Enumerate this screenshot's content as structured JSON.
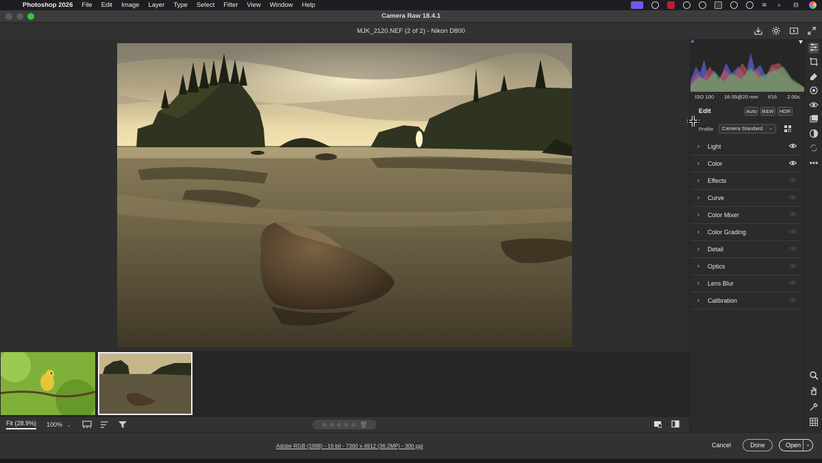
{
  "menubar": {
    "app_name": "Photoshop 2026",
    "items": [
      "File",
      "Edit",
      "Image",
      "Layer",
      "Type",
      "Select",
      "Filter",
      "View",
      "Window",
      "Help"
    ]
  },
  "window": {
    "title": "Camera Raw 18.4.1"
  },
  "filebar": {
    "filename": "MJK_2120.NEF (2 of 2)  -  Nikon D800"
  },
  "filmstrip": {
    "thumbnails": [
      {
        "subject": "yellow-bird-on-branch",
        "selected": false
      },
      {
        "subject": "beach-sea-stacks-sunset",
        "selected": true
      }
    ]
  },
  "bottombar": {
    "zoom_fit": "Fit (28.9%)",
    "zoom_percent": "100%",
    "rating_stars": "☆ ☆ ☆ ☆ ☆",
    "rating_value": 0
  },
  "footer": {
    "image_meta": "Adobe RGB (1998) - 16 bit - 7360 x 4912 (36.2MP) - 300 ppi",
    "cancel_label": "Cancel",
    "done_label": "Done",
    "open_label": "Open"
  },
  "panel": {
    "exif": {
      "iso": "ISO 100",
      "lens": "16-35@20 mm",
      "aperture": "f/16",
      "shutter": "2.00s"
    },
    "edit_label": "Edit",
    "auto_label": "Auto",
    "bw_label": "B&W",
    "hdr_label": "HDR",
    "profile_label": "Profile",
    "profile_value": "Camera Standard",
    "sections": [
      {
        "label": "Light",
        "eye_visible": true
      },
      {
        "label": "Color",
        "eye_visible": true
      },
      {
        "label": "Effects",
        "eye_visible": false
      },
      {
        "label": "Curve",
        "eye_visible": false
      },
      {
        "label": "Color Mixer",
        "eye_visible": false
      },
      {
        "label": "Color Grading",
        "eye_visible": false
      },
      {
        "label": "Detail",
        "eye_visible": false
      },
      {
        "label": "Optics",
        "eye_visible": false
      },
      {
        "label": "Lens Blur",
        "eye_visible": false
      },
      {
        "label": "Calibration",
        "eye_visible": false
      }
    ]
  },
  "colors": {
    "menubar_bg": "#1d1d22",
    "canvas_bg": "#2e2e2e",
    "panel_bg": "#2b2b2b",
    "accent_green": "#2fc642",
    "tray_active": "#6d5ce8"
  }
}
